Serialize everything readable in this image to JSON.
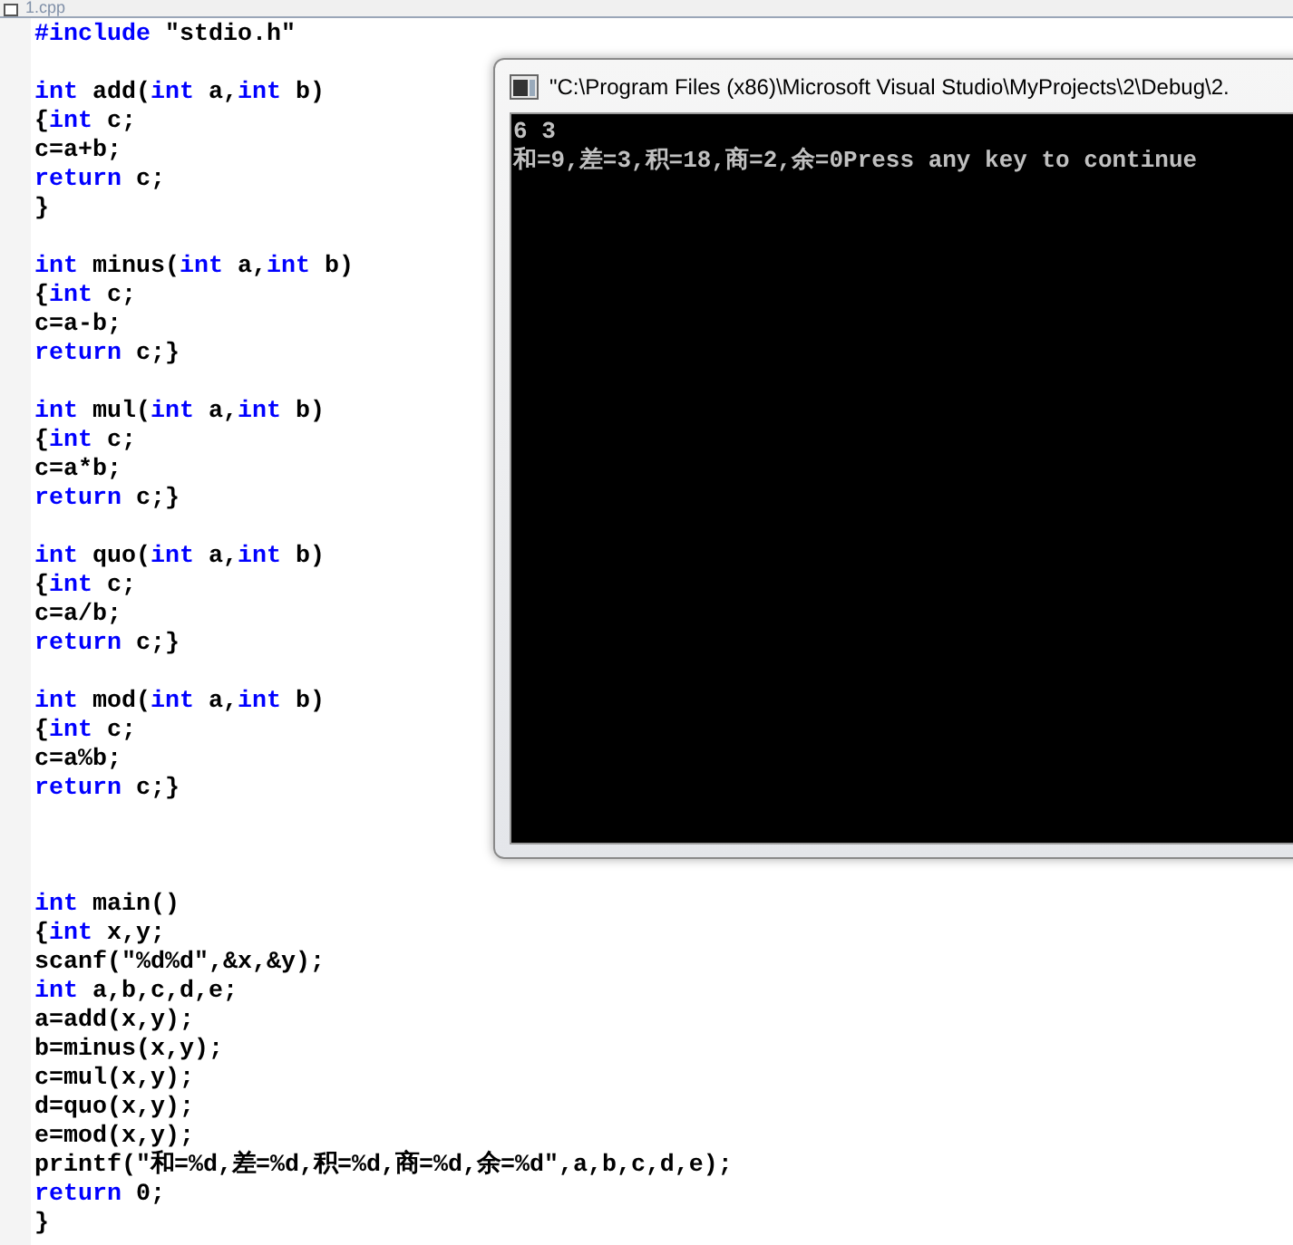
{
  "tab": {
    "label": "1.cpp"
  },
  "editor": {
    "blocks": [
      {
        "kind": "top",
        "lines": [
          [
            {
              "kind": "keyword",
              "text": "#include"
            },
            {
              "kind": "plain",
              "text": " \"stdio.h\""
            }
          ]
        ]
      },
      {
        "kind": "normal",
        "lines": [
          [
            {
              "kind": "keyword",
              "text": "int"
            },
            {
              "kind": "plain",
              "text": " add("
            },
            {
              "kind": "keyword",
              "text": "int"
            },
            {
              "kind": "plain",
              "text": " a,"
            },
            {
              "kind": "keyword",
              "text": "int"
            },
            {
              "kind": "plain",
              "text": " b)"
            }
          ],
          [
            {
              "kind": "plain",
              "text": "{"
            },
            {
              "kind": "keyword",
              "text": "int"
            },
            {
              "kind": "plain",
              "text": " c;"
            }
          ],
          [
            {
              "kind": "plain",
              "text": "c=a+b;"
            }
          ],
          [
            {
              "kind": "keyword",
              "text": "return"
            },
            {
              "kind": "plain",
              "text": " c;"
            }
          ],
          [
            {
              "kind": "plain",
              "text": "}"
            }
          ]
        ]
      },
      {
        "kind": "normal",
        "lines": [
          [
            {
              "kind": "keyword",
              "text": "int"
            },
            {
              "kind": "plain",
              "text": " minus("
            },
            {
              "kind": "keyword",
              "text": "int"
            },
            {
              "kind": "plain",
              "text": " a,"
            },
            {
              "kind": "keyword",
              "text": "int"
            },
            {
              "kind": "plain",
              "text": " b)"
            }
          ],
          [
            {
              "kind": "plain",
              "text": "{"
            },
            {
              "kind": "keyword",
              "text": "int"
            },
            {
              "kind": "plain",
              "text": " c;"
            }
          ],
          [
            {
              "kind": "plain",
              "text": "c=a-b;"
            }
          ],
          [
            {
              "kind": "keyword",
              "text": "return"
            },
            {
              "kind": "plain",
              "text": " c;}"
            }
          ]
        ]
      },
      {
        "kind": "normal",
        "lines": [
          [
            {
              "kind": "keyword",
              "text": "int"
            },
            {
              "kind": "plain",
              "text": " mul("
            },
            {
              "kind": "keyword",
              "text": "int"
            },
            {
              "kind": "plain",
              "text": " a,"
            },
            {
              "kind": "keyword",
              "text": "int"
            },
            {
              "kind": "plain",
              "text": " b)"
            }
          ],
          [
            {
              "kind": "plain",
              "text": "{"
            },
            {
              "kind": "keyword",
              "text": "int"
            },
            {
              "kind": "plain",
              "text": " c;"
            }
          ],
          [
            {
              "kind": "plain",
              "text": "c=a*b;"
            }
          ],
          [
            {
              "kind": "keyword",
              "text": "return"
            },
            {
              "kind": "plain",
              "text": " c;}"
            }
          ]
        ]
      },
      {
        "kind": "normal",
        "lines": [
          [
            {
              "kind": "keyword",
              "text": "int"
            },
            {
              "kind": "plain",
              "text": " quo("
            },
            {
              "kind": "keyword",
              "text": "int"
            },
            {
              "kind": "plain",
              "text": " a,"
            },
            {
              "kind": "keyword",
              "text": "int"
            },
            {
              "kind": "plain",
              "text": " b)"
            }
          ],
          [
            {
              "kind": "plain",
              "text": "{"
            },
            {
              "kind": "keyword",
              "text": "int"
            },
            {
              "kind": "plain",
              "text": " c;"
            }
          ],
          [
            {
              "kind": "plain",
              "text": "c=a/b;"
            }
          ],
          [
            {
              "kind": "keyword",
              "text": "return"
            },
            {
              "kind": "plain",
              "text": " c;}"
            }
          ]
        ]
      },
      {
        "kind": "normal",
        "lines": [
          [
            {
              "kind": "keyword",
              "text": "int"
            },
            {
              "kind": "plain",
              "text": " mod("
            },
            {
              "kind": "keyword",
              "text": "int"
            },
            {
              "kind": "plain",
              "text": " a,"
            },
            {
              "kind": "keyword",
              "text": "int"
            },
            {
              "kind": "plain",
              "text": " b)"
            }
          ],
          [
            {
              "kind": "plain",
              "text": "{"
            },
            {
              "kind": "keyword",
              "text": "int"
            },
            {
              "kind": "plain",
              "text": " c;"
            }
          ],
          [
            {
              "kind": "plain",
              "text": "c=a%b;"
            }
          ],
          [
            {
              "kind": "keyword",
              "text": "return"
            },
            {
              "kind": "plain",
              "text": " c;}"
            }
          ]
        ]
      },
      {
        "kind": "wide_gap",
        "lines": [
          [
            {
              "kind": "keyword",
              "text": "int"
            },
            {
              "kind": "plain",
              "text": " main()"
            }
          ],
          [
            {
              "kind": "plain",
              "text": "{"
            },
            {
              "kind": "keyword",
              "text": "int"
            },
            {
              "kind": "plain",
              "text": " x,y;"
            }
          ],
          [
            {
              "kind": "plain",
              "text": "scanf(\"%d%d\",&x,&y);"
            }
          ],
          [
            {
              "kind": "keyword",
              "text": "int"
            },
            {
              "kind": "plain",
              "text": " a,b,c,d,e;"
            }
          ],
          [
            {
              "kind": "plain",
              "text": "a=add(x,y);"
            }
          ],
          [
            {
              "kind": "plain",
              "text": "b=minus(x,y);"
            }
          ],
          [
            {
              "kind": "plain",
              "text": "c=mul(x,y);"
            }
          ],
          [
            {
              "kind": "plain",
              "text": "d=quo(x,y);"
            }
          ],
          [
            {
              "kind": "plain",
              "text": "e=mod(x,y);"
            }
          ],
          [
            {
              "kind": "plain",
              "text": "printf(\"和=%d,差=%d,积=%d,商=%d,余=%d\",a,b,c,d,e);"
            }
          ],
          [
            {
              "kind": "keyword",
              "text": "return"
            },
            {
              "kind": "plain",
              "text": " 0;"
            }
          ],
          [
            {
              "kind": "plain",
              "text": "}"
            }
          ]
        ]
      }
    ]
  },
  "console": {
    "title": "\"C:\\Program Files (x86)\\Microsoft Visual Studio\\MyProjects\\2\\Debug\\2.",
    "lines": [
      "6 3",
      "和=9,差=3,积=18,商=2,余=0Press any key to continue"
    ]
  }
}
